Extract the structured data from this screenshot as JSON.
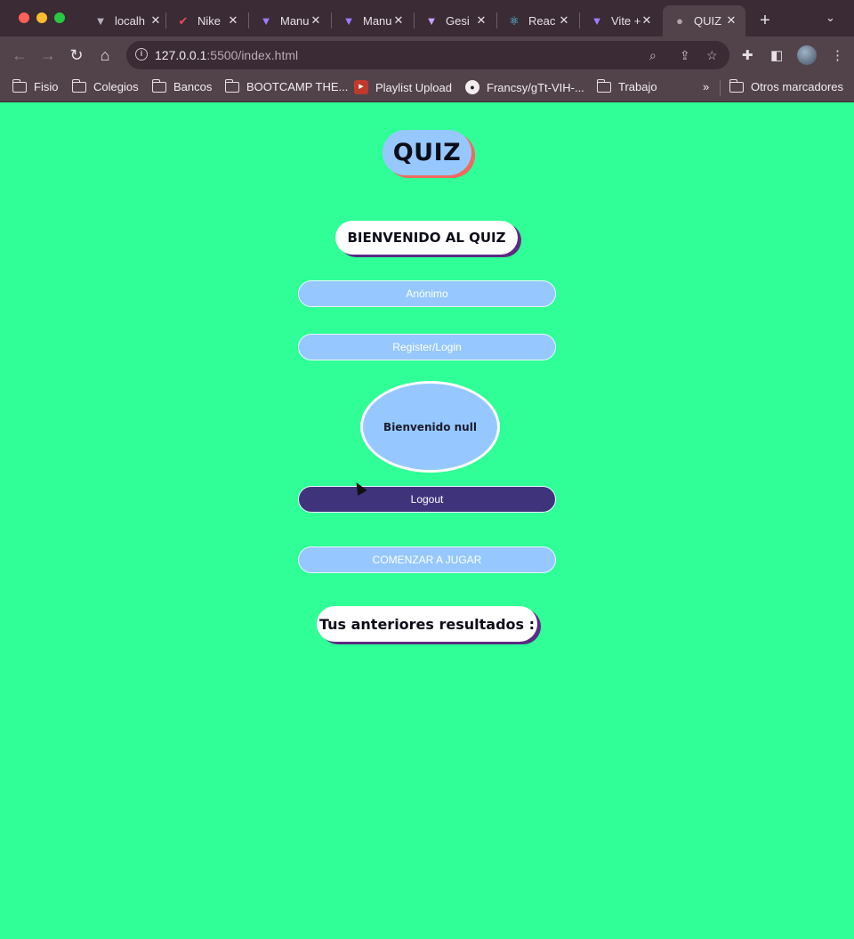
{
  "browser": {
    "tabs": [
      {
        "title": "localh",
        "icon": "vite-icon"
      },
      {
        "title": "Nike",
        "icon": "nike-icon"
      },
      {
        "title": "Manu",
        "icon": "vite-icon"
      },
      {
        "title": "Manu",
        "icon": "vite-icon"
      },
      {
        "title": "Gesi",
        "icon": "vite-icon"
      },
      {
        "title": "Reac",
        "icon": "react-icon"
      },
      {
        "title": "Vite +",
        "icon": "vite-icon"
      },
      {
        "title": "QUIZ",
        "icon": "globe-icon",
        "active": true
      }
    ],
    "url_host": "127.0.0.1",
    "url_rest": ":5500/index.html",
    "bookmarks": [
      {
        "label": "Fisio",
        "icon": "folder-icon"
      },
      {
        "label": "Colegios",
        "icon": "folder-icon"
      },
      {
        "label": "Bancos",
        "icon": "folder-icon"
      },
      {
        "label": "BOOTCAMP THE...",
        "icon": "folder-icon"
      },
      {
        "label": "Playlist Upload",
        "icon": "playlist-icon"
      },
      {
        "label": "Francsy/gTt-VIH-...",
        "icon": "github-icon"
      },
      {
        "label": "Trabajo",
        "icon": "folder-icon"
      }
    ],
    "more_bookmarks": "»",
    "other_bookmarks": "Otros marcadores"
  },
  "page": {
    "title": "QUIZ",
    "welcome_heading": "BIENVENIDO AL QUIZ",
    "anon_button": "Anónimo",
    "register_button": "Register/Login",
    "greeting": "Bienvenido null",
    "logout_button": "Logout",
    "play_button": "COMENZAR A JUGAR",
    "results_heading": "Tus anteriores resultados :"
  },
  "colors": {
    "background": "#30fe96",
    "pill": "#96c8ff",
    "logout": "#3f347c",
    "shadow_accent": "#5b2c83",
    "quiz_shadow": "#f06a5e"
  }
}
